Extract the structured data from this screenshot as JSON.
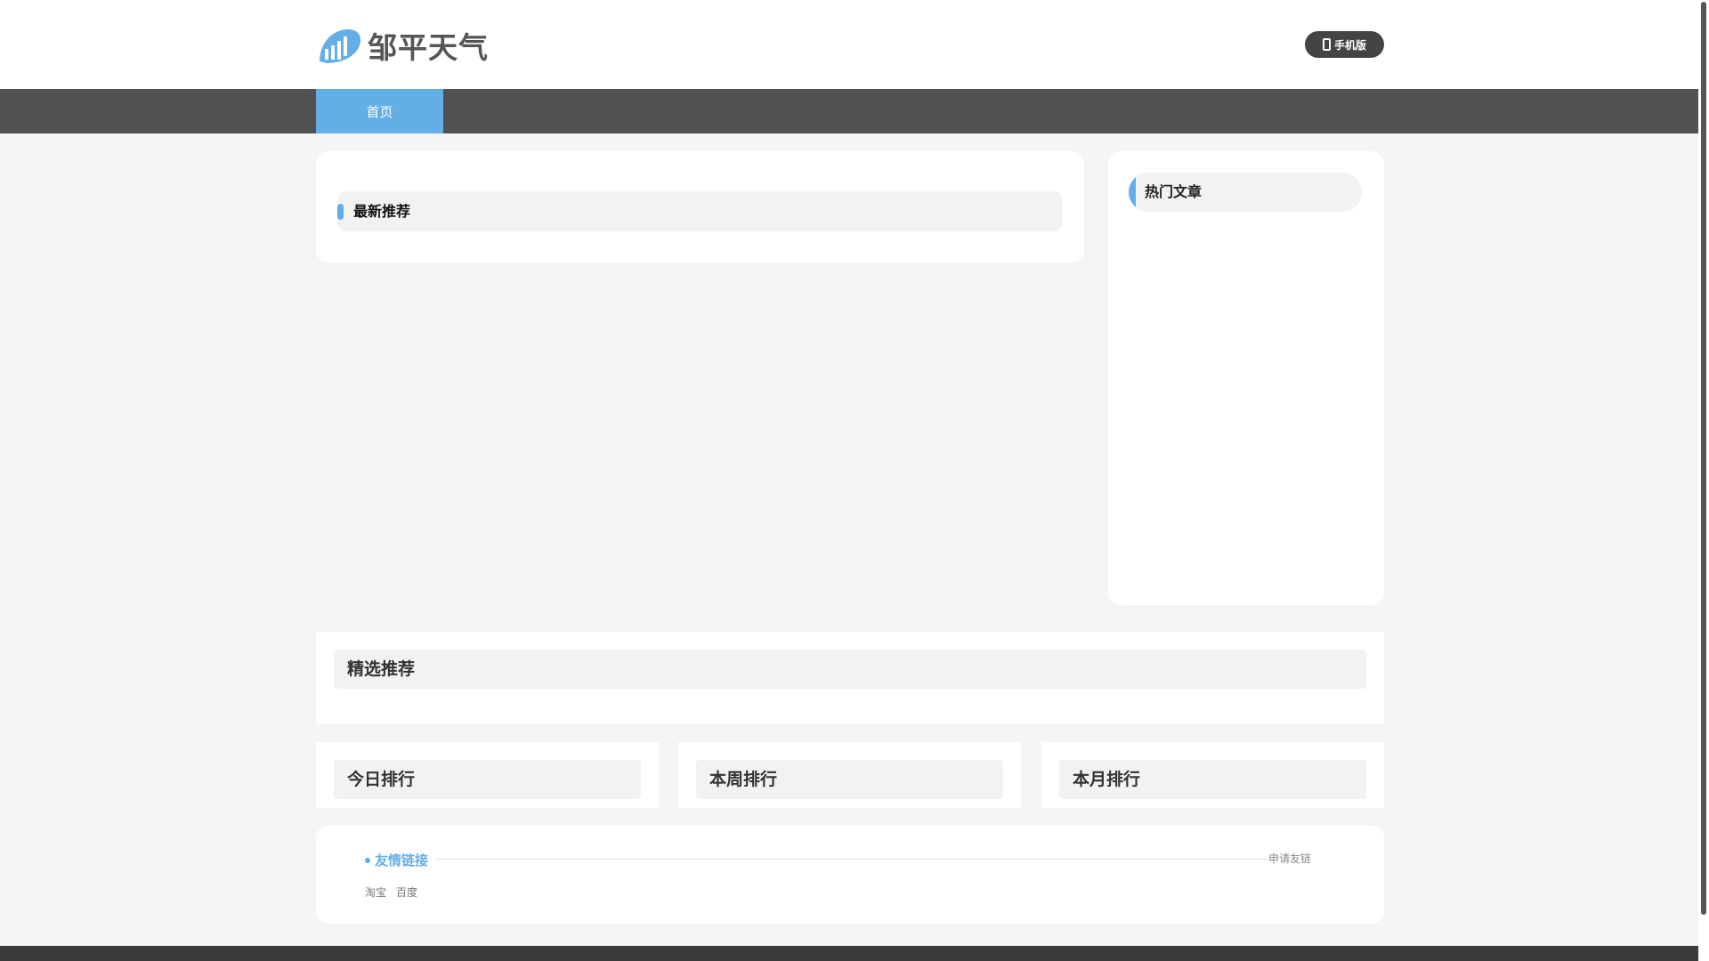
{
  "site": {
    "name": "邹平天气",
    "mobile_label": "手机版"
  },
  "nav": {
    "items": [
      {
        "label": "首页"
      }
    ]
  },
  "sections": {
    "latest": "最新推荐",
    "hot": "热门文章",
    "featured": "精选推荐",
    "rank_today": "今日排行",
    "rank_week": "本周排行",
    "rank_month": "本月排行"
  },
  "links": {
    "title": "友情链接",
    "apply": "申请友链",
    "items": [
      "淘宝",
      "百度"
    ]
  },
  "footer": {
    "text": ""
  },
  "colors": {
    "accent": "#64aee8",
    "nav_bg": "#515151",
    "page_bg": "#f5f5f5"
  }
}
